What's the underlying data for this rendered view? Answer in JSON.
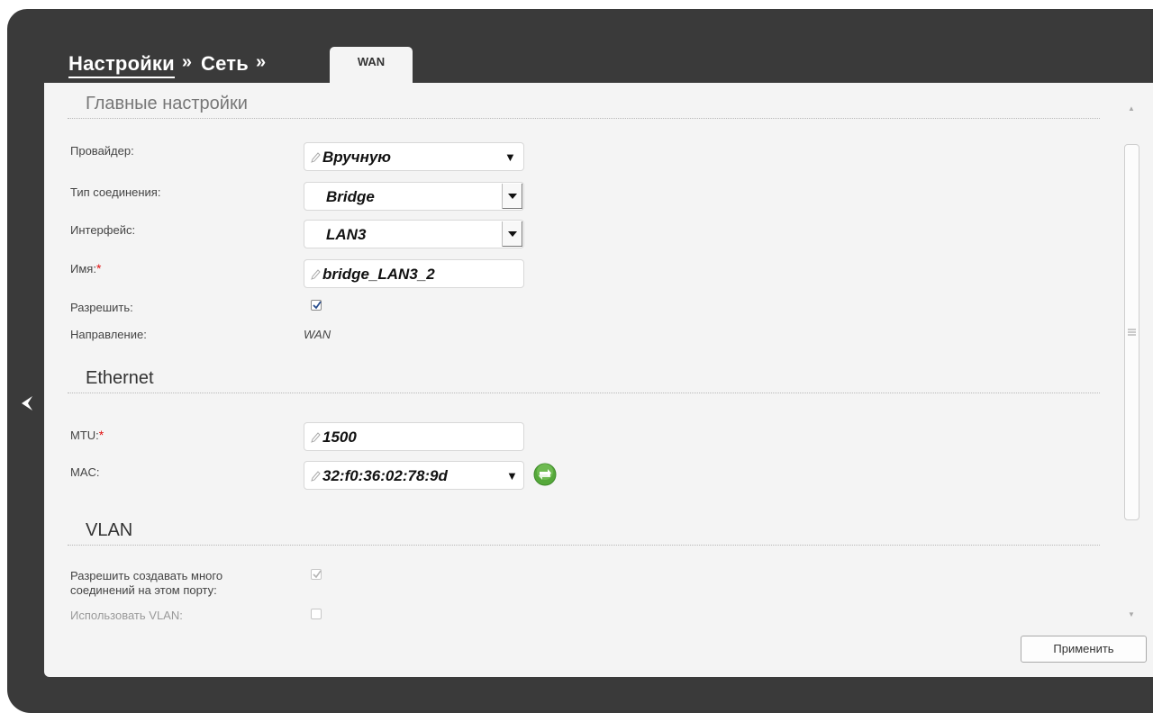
{
  "breadcrumb": {
    "settings": "Настройки",
    "network": "Сеть",
    "separator": "»",
    "active_tab": "WAN"
  },
  "sections": {
    "main": "Главные настройки",
    "ethernet": "Ethernet",
    "vlan": "VLAN"
  },
  "fields": {
    "provider": {
      "label": "Провайдер:",
      "value": "Вручную"
    },
    "connection_type": {
      "label": "Тип соединения:",
      "value": "Bridge"
    },
    "interface": {
      "label": "Интерфейс:",
      "value": "LAN3"
    },
    "name": {
      "label": "Имя:",
      "value": "bridge_LAN3_2"
    },
    "enable": {
      "label": "Разрешить:",
      "checked": true
    },
    "direction": {
      "label": "Направление:",
      "value": "WAN"
    },
    "mtu": {
      "label": "MTU:",
      "value": "1500"
    },
    "mac": {
      "label": "MAC:",
      "value": "32:f0:36:02:78:9d"
    },
    "multi_conn": {
      "label_line1": "Разрешить создавать много",
      "label_line2": "соединений на этом порту:",
      "checked": true
    },
    "use_vlan": {
      "label": "Использовать VLAN:",
      "checked": false
    }
  },
  "required_mark": "*",
  "dropdown_caret": "▼",
  "apply_button": "Применить",
  "icons": {
    "back": "chevron-left-icon",
    "edit": "pencil-icon",
    "refresh": "refresh-icon"
  },
  "colors": {
    "frame": "#3a3a3a",
    "panel": "#f4f4f4",
    "required": "#e01010",
    "refresh": "#55a83a"
  }
}
